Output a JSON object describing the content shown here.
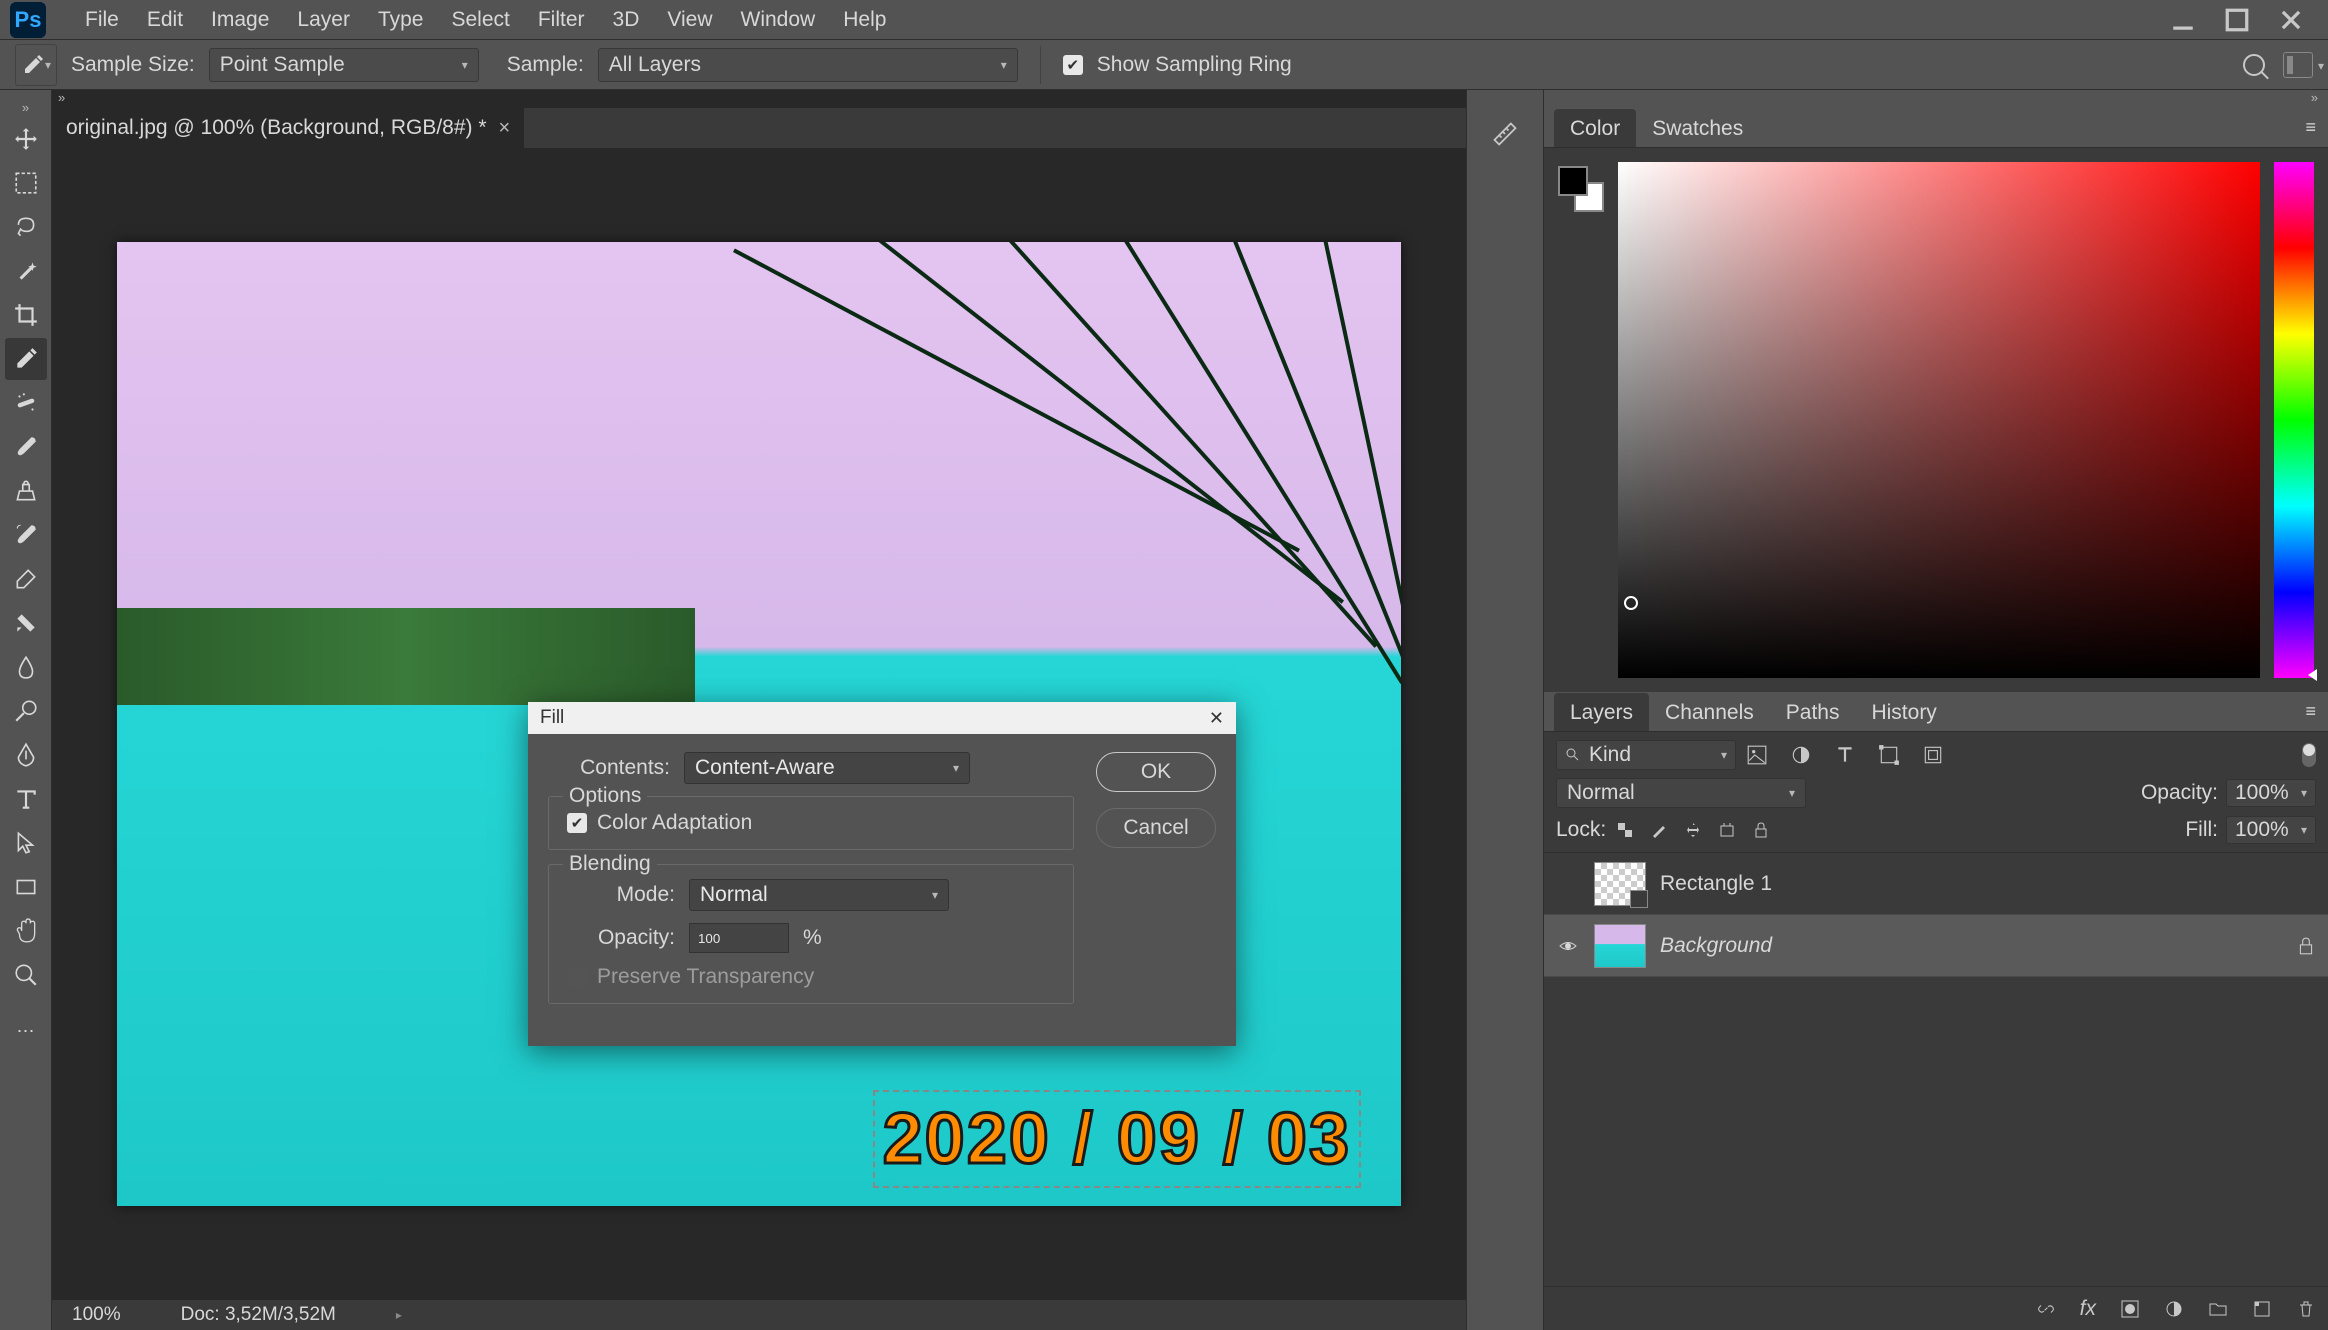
{
  "menu": {
    "items": [
      "File",
      "Edit",
      "Image",
      "Layer",
      "Type",
      "Select",
      "Filter",
      "3D",
      "View",
      "Window",
      "Help"
    ]
  },
  "options_bar": {
    "sample_size_label": "Sample Size:",
    "sample_size_value": "Point Sample",
    "sample_label": "Sample:",
    "sample_value": "All Layers",
    "show_ring_label": "Show Sampling Ring",
    "show_ring_checked": true
  },
  "document": {
    "tab_title": "original.jpg @ 100% (Background, RGB/8#) *",
    "date_stamp": "2020 / 09 / 03"
  },
  "fill_dialog": {
    "title": "Fill",
    "contents_label": "Contents:",
    "contents_value": "Content-Aware",
    "options_label": "Options",
    "color_adapt_label": "Color Adaptation",
    "color_adapt_checked": true,
    "blending_label": "Blending",
    "mode_label": "Mode:",
    "mode_value": "Normal",
    "opacity_label": "Opacity:",
    "opacity_value": "100",
    "opacity_unit": "%",
    "preserve_label": "Preserve Transparency",
    "ok": "OK",
    "cancel": "Cancel"
  },
  "status": {
    "zoom": "100%",
    "doc_info": "Doc: 3,52M/3,52M"
  },
  "color_panel": {
    "tab_color": "Color",
    "tab_swatches": "Swatches"
  },
  "layers_panel": {
    "tab_layers": "Layers",
    "tab_channels": "Channels",
    "tab_paths": "Paths",
    "tab_history": "History",
    "kind_label": "Kind",
    "mode_value": "Normal",
    "opacity_label": "Opacity:",
    "opacity_value": "100%",
    "lock_label": "Lock:",
    "fill_label": "Fill:",
    "fill_value": "100%",
    "layers": [
      {
        "name": "Rectangle 1",
        "visible": false,
        "selected": false,
        "italic": false,
        "locked": false,
        "thumb": "transparent",
        "vector": true
      },
      {
        "name": "Background",
        "visible": true,
        "selected": true,
        "italic": true,
        "locked": true,
        "thumb": "beach",
        "vector": false
      }
    ]
  }
}
